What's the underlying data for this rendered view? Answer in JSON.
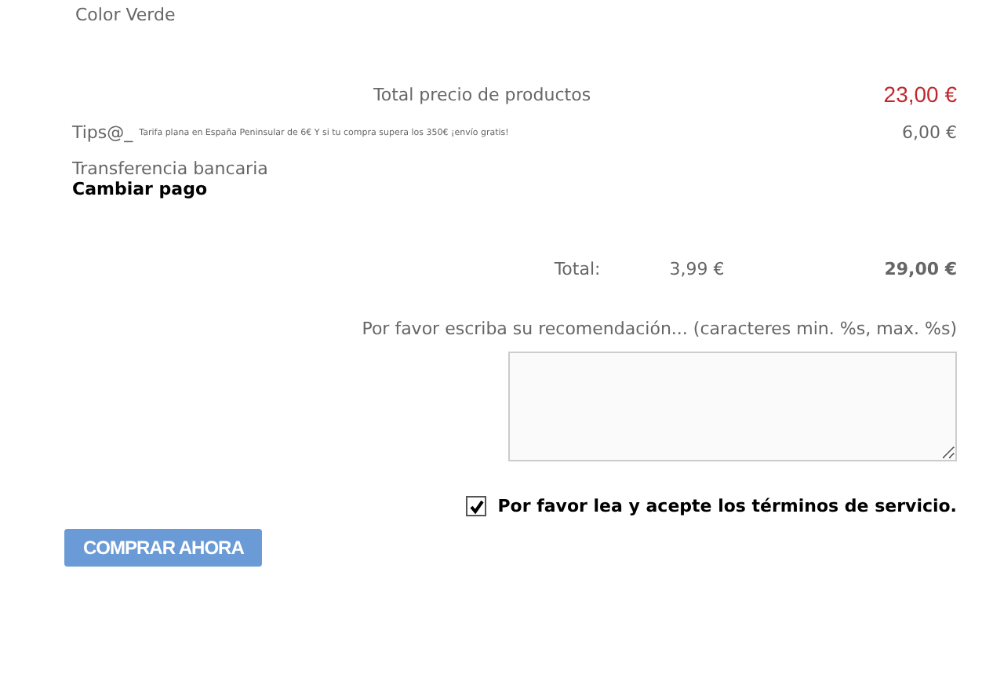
{
  "product": {
    "variant": "Color Verde"
  },
  "summary": {
    "products_label": "Total precio de productos",
    "products_price": "23,00 €"
  },
  "shipping": {
    "label": "Tips@_",
    "note": "Tarifa plana en España Peninsular de 6€ Y si tu compra supera los 350€ ¡envío gratis!",
    "price": "6,00 €"
  },
  "payment": {
    "method": "Transferencia bancaria",
    "change_link": "Cambiar pago"
  },
  "total": {
    "label": "Total:",
    "tax": "3,99 €",
    "amount": "29,00 €"
  },
  "recommendation": {
    "label": "Por favor escriba su recomendación... (caracteres min. %s, max. %s)"
  },
  "terms": {
    "checked": true,
    "label": "Por favor lea y acepte los términos de servicio."
  },
  "buy_button": "COMPRAR AHORA"
}
